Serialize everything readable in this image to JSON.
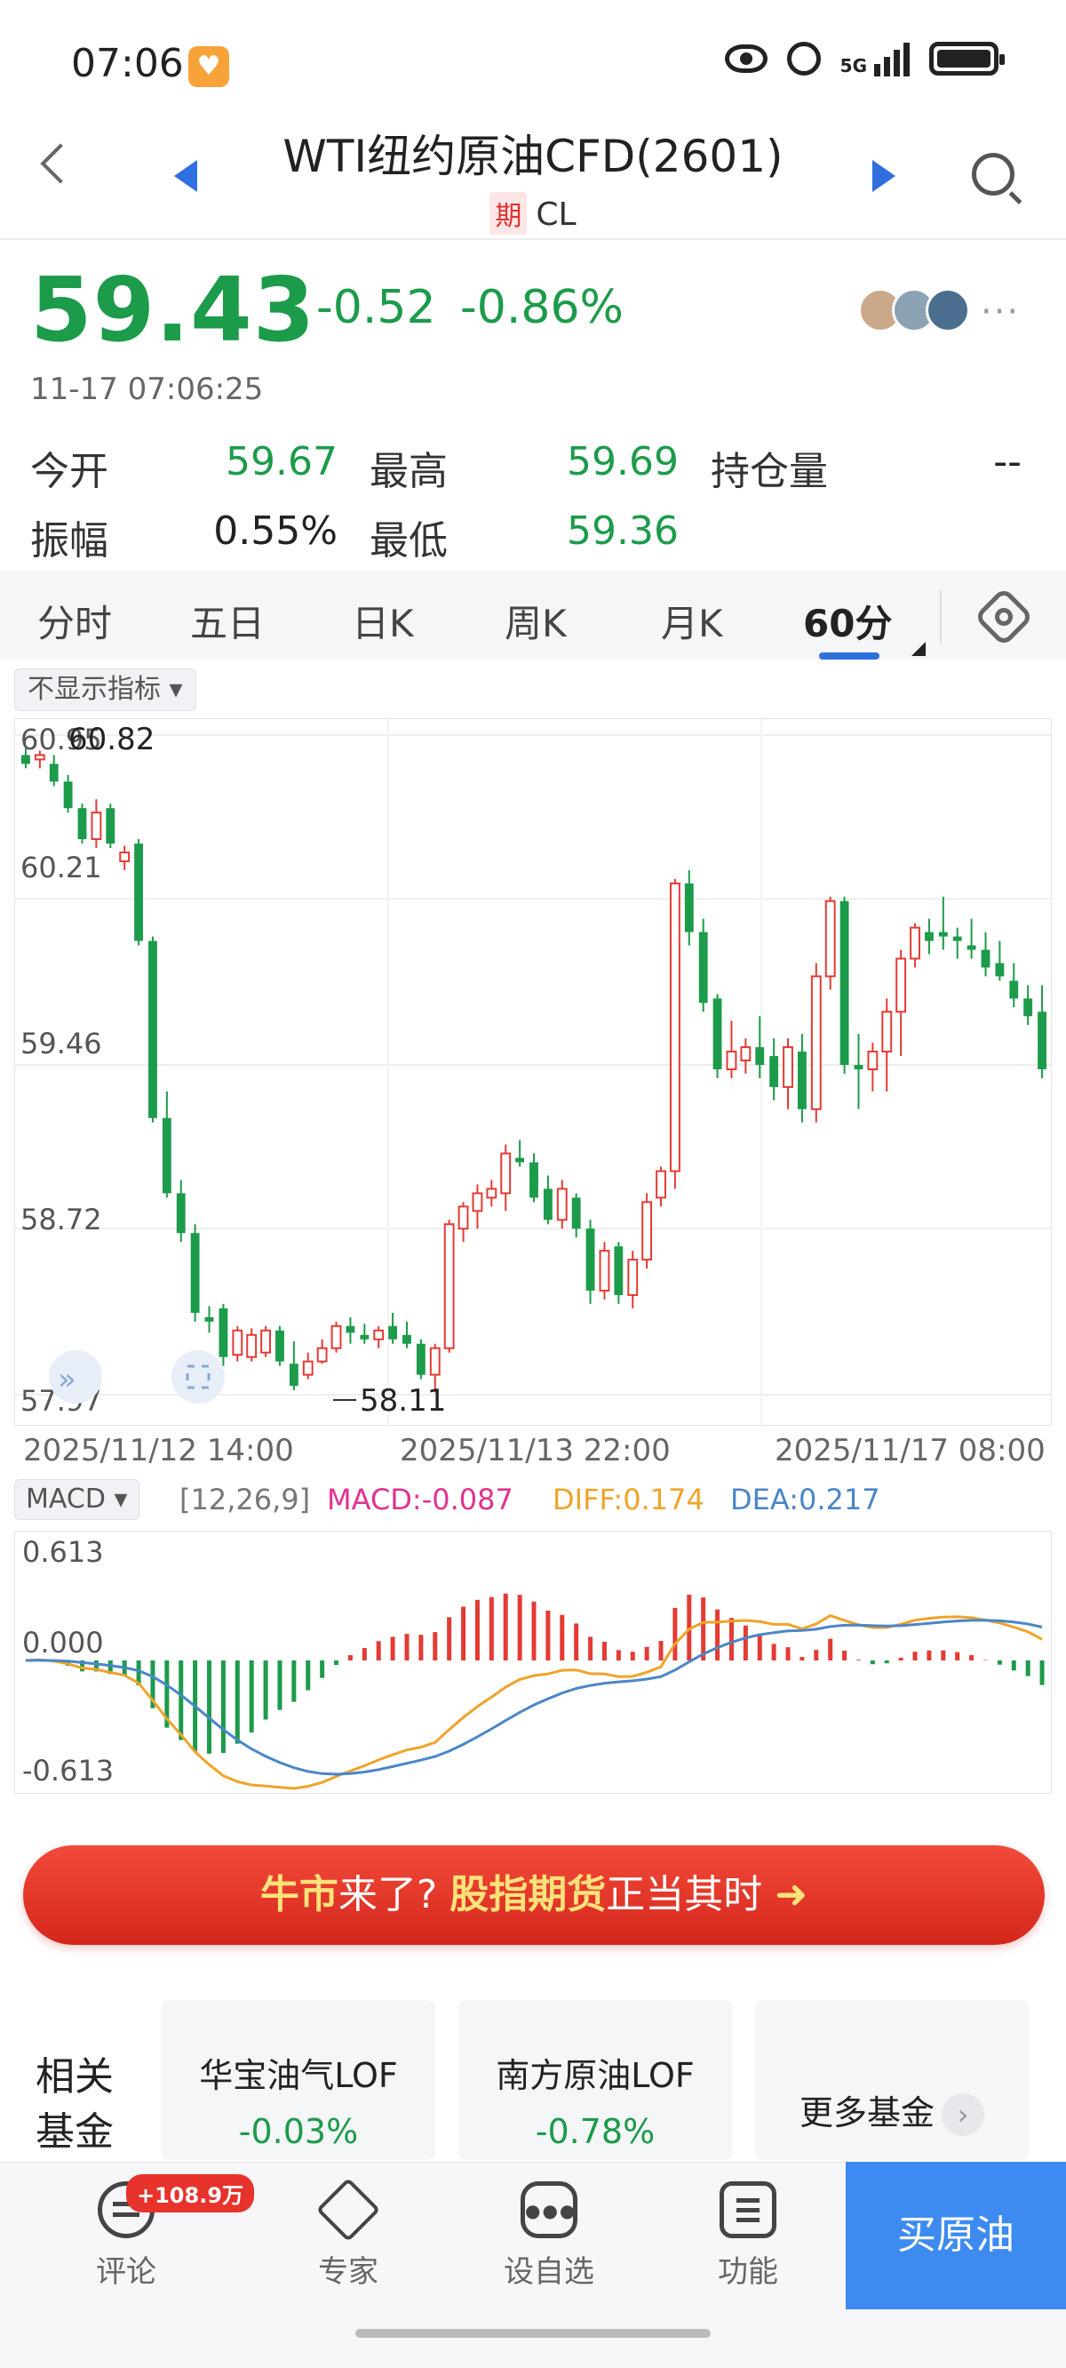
{
  "status_bar": {
    "time": "07:06",
    "network": "5G"
  },
  "header": {
    "title": "WTI纽约原油CFD(2601)",
    "type_tag": "期",
    "symbol": "CL"
  },
  "quote": {
    "price": "59.43",
    "change": "-0.52",
    "change_pct": "-0.86%",
    "timestamp": "11-17 07:06:25",
    "more": "···"
  },
  "stats": {
    "open_label": "今开",
    "open_value": "59.67",
    "high_label": "最高",
    "high_value": "59.69",
    "oi_label": "持仓量",
    "oi_value": "--",
    "amp_label": "振幅",
    "amp_value": "0.55%",
    "low_label": "最低",
    "low_value": "59.36"
  },
  "tabs": [
    "分时",
    "五日",
    "日K",
    "周K",
    "月K",
    "60分"
  ],
  "indicator_toggle": "不显示指标 ▾",
  "chart": {
    "y_labels": [
      "60.95",
      "60.21",
      "59.46",
      "58.72",
      "57.97"
    ],
    "max_label": "60.82",
    "min_label": "58.11",
    "x_labels": [
      "2025/11/12 14:00",
      "2025/11/13 22:00",
      "2025/11/17 08:00"
    ]
  },
  "macd": {
    "selector": "MACD ▾",
    "params": "[12,26,9]",
    "macd_text": "MACD:-0.087",
    "diff_text": "DIFF:0.174",
    "dea_text": "DEA:0.217",
    "y_labels": [
      "0.613",
      "0.000",
      "-0.613"
    ]
  },
  "colors": {
    "up": "#e33b34",
    "down": "#1c9b4a",
    "accent": "#2f6fde",
    "diff": "#f0a32a",
    "dea": "#4a86c8",
    "macd": "#e0338f"
  },
  "chart_data": {
    "type": "candlestick",
    "title": "",
    "xlabel": "",
    "ylabel": "",
    "ylim": [
      57.97,
      60.95
    ],
    "x_ticks": [
      "2025/11/12 14:00",
      "2025/11/13 22:00",
      "2025/11/17 08:00"
    ],
    "candles": [
      [
        60.86,
        60.89,
        60.8,
        60.82
      ],
      [
        60.84,
        60.88,
        60.8,
        60.86
      ],
      [
        60.82,
        60.86,
        60.72,
        60.74
      ],
      [
        60.74,
        60.77,
        60.6,
        60.62
      ],
      [
        60.62,
        60.64,
        60.46,
        60.48
      ],
      [
        60.48,
        60.66,
        60.44,
        60.6
      ],
      [
        60.62,
        60.64,
        60.44,
        60.46
      ],
      [
        60.38,
        60.45,
        60.34,
        60.42
      ],
      [
        60.46,
        60.48,
        60.0,
        60.02
      ],
      [
        60.02,
        60.04,
        59.2,
        59.22
      ],
      [
        59.22,
        59.34,
        58.86,
        58.88
      ],
      [
        58.88,
        58.94,
        58.66,
        58.7
      ],
      [
        58.7,
        58.74,
        58.3,
        58.34
      ],
      [
        58.32,
        58.37,
        58.25,
        58.3
      ],
      [
        58.36,
        58.38,
        58.1,
        58.14
      ],
      [
        58.15,
        58.28,
        58.12,
        58.26
      ],
      [
        58.14,
        58.27,
        58.12,
        58.24
      ],
      [
        58.16,
        58.28,
        58.14,
        58.26
      ],
      [
        58.26,
        58.28,
        58.1,
        58.12
      ],
      [
        58.11,
        58.21,
        57.99,
        58.01
      ],
      [
        58.06,
        58.16,
        58.04,
        58.12
      ],
      [
        58.12,
        58.22,
        58.11,
        58.18
      ],
      [
        58.18,
        58.3,
        58.16,
        58.28
      ],
      [
        58.28,
        58.32,
        58.2,
        58.25
      ],
      [
        58.24,
        58.29,
        58.2,
        58.22
      ],
      [
        58.22,
        58.28,
        58.18,
        58.26
      ],
      [
        58.28,
        58.34,
        58.2,
        58.22
      ],
      [
        58.24,
        58.3,
        58.18,
        58.2
      ],
      [
        58.2,
        58.22,
        58.04,
        58.06
      ],
      [
        58.06,
        58.2,
        57.98,
        58.18
      ],
      [
        58.18,
        58.76,
        58.16,
        58.74
      ],
      [
        58.72,
        58.84,
        58.66,
        58.82
      ],
      [
        58.8,
        58.92,
        58.72,
        58.88
      ],
      [
        58.86,
        58.94,
        58.82,
        58.9
      ],
      [
        58.88,
        59.1,
        58.8,
        59.06
      ],
      [
        59.04,
        59.12,
        59.0,
        59.02
      ],
      [
        59.02,
        59.06,
        58.84,
        58.86
      ],
      [
        58.9,
        58.96,
        58.74,
        58.76
      ],
      [
        58.76,
        58.94,
        58.72,
        58.9
      ],
      [
        58.86,
        58.88,
        58.68,
        58.72
      ],
      [
        58.72,
        58.76,
        58.38,
        58.44
      ],
      [
        58.44,
        58.66,
        58.4,
        58.62
      ],
      [
        58.64,
        58.66,
        58.38,
        58.42
      ],
      [
        58.42,
        58.62,
        58.36,
        58.58
      ],
      [
        58.58,
        58.88,
        58.54,
        58.84
      ],
      [
        58.86,
        59.0,
        58.82,
        58.98
      ],
      [
        58.98,
        60.3,
        58.9,
        60.28
      ],
      [
        60.28,
        60.34,
        60.0,
        60.06
      ],
      [
        60.06,
        60.12,
        59.7,
        59.74
      ],
      [
        59.76,
        59.78,
        59.4,
        59.44
      ],
      [
        59.44,
        59.66,
        59.4,
        59.52
      ],
      [
        59.48,
        59.58,
        59.42,
        59.54
      ],
      [
        59.54,
        59.68,
        59.4,
        59.46
      ],
      [
        59.5,
        59.58,
        59.3,
        59.36
      ],
      [
        59.36,
        59.58,
        59.26,
        59.54
      ],
      [
        59.52,
        59.6,
        59.2,
        59.26
      ],
      [
        59.26,
        59.92,
        59.2,
        59.86
      ],
      [
        59.86,
        60.22,
        59.8,
        60.2
      ],
      [
        60.2,
        60.22,
        59.42,
        59.46
      ],
      [
        59.46,
        59.6,
        59.26,
        59.44
      ],
      [
        59.44,
        59.56,
        59.34,
        59.52
      ],
      [
        59.52,
        59.76,
        59.34,
        59.7
      ],
      [
        59.7,
        59.98,
        59.5,
        59.94
      ],
      [
        59.94,
        60.1,
        59.9,
        60.08
      ],
      [
        60.06,
        60.12,
        59.96,
        60.02
      ],
      [
        60.06,
        60.22,
        59.98,
        60.04
      ],
      [
        60.04,
        60.08,
        59.94,
        60.02
      ],
      [
        60.0,
        60.12,
        59.94,
        59.98
      ],
      [
        59.98,
        60.06,
        59.86,
        59.9
      ],
      [
        59.92,
        60.02,
        59.84,
        59.86
      ],
      [
        59.84,
        59.92,
        59.72,
        59.76
      ],
      [
        59.76,
        59.82,
        59.64,
        59.68
      ],
      [
        59.7,
        59.82,
        59.4,
        59.44
      ]
    ],
    "macd_ylim": [
      -0.613,
      0.613
    ]
  }
}
